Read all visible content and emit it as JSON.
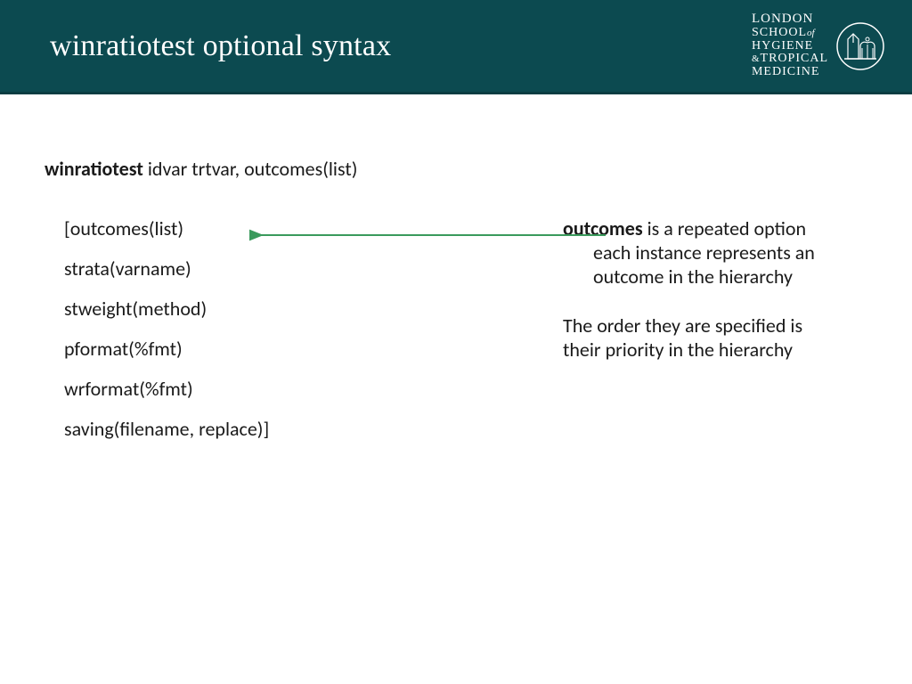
{
  "header": {
    "title": "winratiotest optional syntax",
    "logo": {
      "line1": "LONDON",
      "line2a": "SCHOOL",
      "line2b": "of",
      "line3a": "HYGIENE",
      "line3b": "&",
      "line3c": "TROPICAL",
      "line4": "MEDICINE"
    }
  },
  "cmdline": {
    "cmd": "winratiotest",
    "args": " idvar trtvar, outcomes(list)"
  },
  "options": [
    "[outcomes(list)",
    "strata(varname)",
    "stweight(method)",
    "pformat(%fmt)",
    "wrformat(%fmt)",
    "saving(filename, replace)]"
  ],
  "right": {
    "p1_bold": "outcomes",
    "p1_rest": " is a repeated option",
    "p1_indent1": "each instance represents an",
    "p1_indent2": "outcome in the hierarchy",
    "p2_line1": "The order they are specified is",
    "p2_line2": "their priority in the hierarchy"
  },
  "colors": {
    "arrow": "#3a9a5c"
  }
}
